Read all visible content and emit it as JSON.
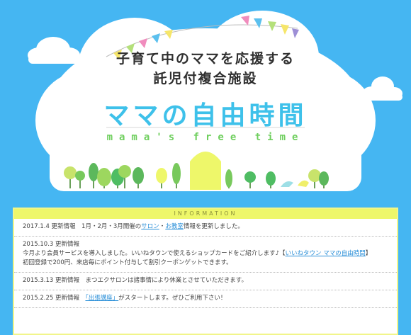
{
  "colors": {
    "sky": "#45b6f2",
    "brand": "#3ec1ea",
    "sub": "#6fcf5e",
    "door": "#eef76a"
  },
  "hero": {
    "tagline_1": "子育て中のママを応援する",
    "tagline_2": "託児付複合施設",
    "brand_title": "ママの自由時間",
    "brand_sub": "mama's free time"
  },
  "information": {
    "heading": "INFORMATION",
    "entries": [
      {
        "a": "2017.1.4 更新情報　1月・2月・3月開催の",
        "link1": "サロン",
        "b": "・",
        "link2": "お教室",
        "c": "情報を更新しました。"
      },
      {
        "line1": "2015.10.3 更新情報",
        "line2a": "今月より会員サービスを導入しました。いいねタウンで使えるショップカードをご紹介します♪【",
        "line2link": "いいねタウン ママの自由時間",
        "line2b": "】",
        "line3": "初回登録で200円、来店毎にポイント付与して割引クーポンゲットできます。"
      },
      {
        "text": "2015.3.13 更新情報　まつエクサロンは諸事情により休業とさせていただきます。"
      },
      {
        "a": "2015.2.25 更新情報　",
        "link": "「出張講座」",
        "b": "がスタートします。ぜひご利用下さい！"
      }
    ]
  }
}
